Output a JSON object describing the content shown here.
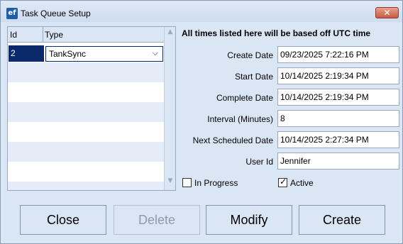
{
  "window": {
    "title": "Task Queue Setup",
    "app_icon_text": "ef",
    "close_glyph": "✕"
  },
  "grid": {
    "columns": [
      "Id",
      "Type"
    ],
    "rows": [
      {
        "id": "2",
        "type": "TankSync"
      }
    ]
  },
  "form": {
    "notice": "All times listed here will be based off UTC time",
    "fields": {
      "create_date": {
        "label": "Create Date",
        "value": "09/23/2025 7:22:16 PM"
      },
      "start_date": {
        "label": "Start Date",
        "value": "10/14/2025 2:19:34 PM"
      },
      "complete_date": {
        "label": "Complete Date",
        "value": "10/14/2025 2:19:34 PM"
      },
      "interval": {
        "label": "Interval (Minutes)",
        "value": "8"
      },
      "next_scheduled": {
        "label": "Next Scheduled Date",
        "value": "10/14/2025 2:27:34 PM"
      },
      "user_id": {
        "label": "User Id",
        "value": "Jennifer"
      }
    },
    "checks": {
      "in_progress": {
        "label": "In Progress",
        "checked": false
      },
      "active": {
        "label": "Active",
        "checked": true
      }
    }
  },
  "buttons": {
    "close": "Close",
    "delete": "Delete",
    "modify": "Modify",
    "create": "Create"
  }
}
